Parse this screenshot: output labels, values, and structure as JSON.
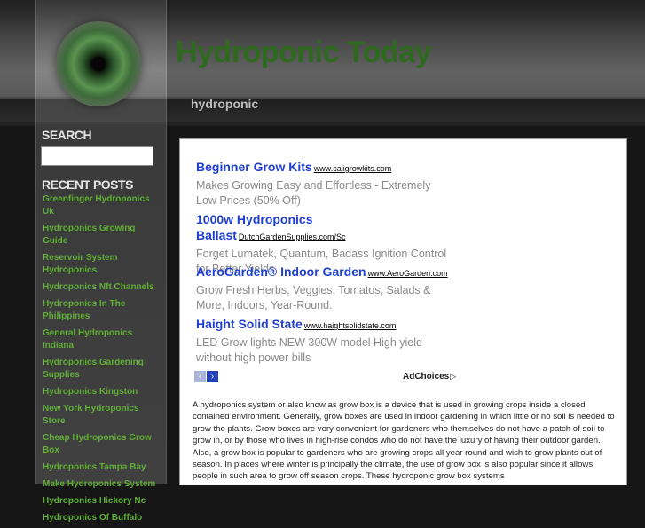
{
  "site": {
    "title": "Hydroponic Today",
    "tagline": "hydroponic"
  },
  "sidebar": {
    "search_heading": "SEARCH",
    "search_value": "",
    "recent_heading": "RECENT POSTS",
    "posts": [
      "Greenfinger Hydroponics Uk",
      "Hydroponics Growing Guide",
      "Reservoir System Hydroponics",
      "Hydroponics Nft Channels",
      "Hydroponics In The Philippines",
      "General Hydroponics Indiana",
      "Hydroponics Gardening Supplies",
      "Hydroponics Kingston",
      "New York Hydroponics Store",
      "Cheap Hydroponics Grow Box",
      "Hydroponics Tampa Bay",
      "Make Hydroponics System",
      "Hydroponics Hickory Nc",
      "Hydroponics Of Buffalo"
    ]
  },
  "ads": [
    {
      "title": "Beginner Grow Kits",
      "url": "www.caligrowkits.com",
      "desc": "Makes Growing Easy and Effortless - Extremely Low Prices (50% Off)"
    },
    {
      "title": "1000w Hydroponics Ballast",
      "url": "DutchGardenSupplies.com/Sc",
      "desc": "Forget Lumatek, Quantum, Badass Ignition Control for Better Yields"
    },
    {
      "title": "AeroGarden® Indoor Garden",
      "url": "www.AeroGarden.com",
      "desc": "Grow Fresh Herbs, Veggies, Tomatos, Salads & More, Indoors, Year-Round."
    },
    {
      "title": "Haight Solid State",
      "url": "www.haightsolidstate.com",
      "desc": "LED Grow lights NEW 300W model High yield without high power bills"
    }
  ],
  "adnav": {
    "prev": "‹",
    "next": "›",
    "adchoices": "AdChoices",
    "adchoices_icon": "▷"
  },
  "article": {
    "text": "A hydroponics system or also know as grow box is a device that is used in growing crops inside a closed contained environment. Generally, grow boxes are used in indoor gardening in which little or no soil is needed to grow the plants. Grow boxes are very convenient for gardeners who themselves do not have a patch of soil to grow in, or by those who lives in high-rise condos who do not have the luxury of having their outdoor garden. Also, a grow box is popular to gardeners who are growing crops all year round and wish to grow plants out of season. In places where winter is principally the climate, the use of grow box is also popular since it allows people in such area to grow off season crops. These hydroponic grow box systems"
  },
  "colors": {
    "title_green": "#2d6a1e",
    "link_green": "#5fae35",
    "ad_blue": "#1f3fcf"
  }
}
